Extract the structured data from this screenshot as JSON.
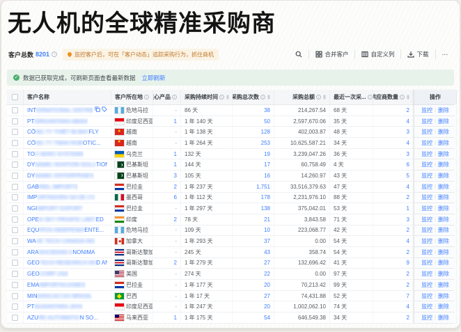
{
  "page": {
    "title": "无人机的全球精准采购商"
  },
  "toolbar": {
    "total_label": "客户总数",
    "total_value": "8201",
    "notice": "监控客户后，可在「客户动态」追踪采购行为，抓住商机",
    "buttons": {
      "merge": "合并客户",
      "customize": "自定义列",
      "download": "下载",
      "more": "⋯"
    }
  },
  "alert": {
    "text": "数据已获取完成，可刷新页面查看最新数据",
    "link": "立即刷新"
  },
  "colors": {
    "accent": "#3d7eff",
    "success": "#4caf6e",
    "warning": "#f08c1f",
    "notice_text": "#c07a2e"
  },
  "table": {
    "columns": [
      {
        "label": "客户名称",
        "info": false,
        "sort": false
      },
      {
        "label": "客户所在地",
        "info": true,
        "sort": false
      },
      {
        "label": "核心产品",
        "info": true,
        "sort": false
      },
      {
        "label": "采购持续时间",
        "info": true,
        "sort": true
      },
      {
        "label": "采购总次数",
        "info": true,
        "sort": true
      },
      {
        "label": "采购总额",
        "info": true,
        "sort": true
      },
      {
        "label": "最近一次采...",
        "info": true,
        "sort": true
      },
      {
        "label": "供应商数量",
        "info": true,
        "sort": true
      },
      {
        "label": "操作",
        "info": false,
        "sort": false
      }
    ],
    "actions": {
      "monitor": "监控",
      "delete": "删除"
    },
    "rows": [
      {
        "pre": "INT",
        "mid": "ERNATIONAL DISTRIB",
        "suf": "...",
        "icons": true,
        "country": "危地马拉",
        "flag": "gt",
        "core": "-",
        "duration": "86 天",
        "count": "38",
        "amount": "214,267.54",
        "last": "68 天",
        "sup": "2"
      },
      {
        "pre": "PT ",
        "mid": "DIRGANTARA ABADI",
        "suf": "",
        "country": "印度尼西亚",
        "flag": "id",
        "core": "1",
        "duration": "1 年 140 天",
        "count": "50",
        "amount": "2,597,670.06",
        "last": "35 天",
        "sup": "4"
      },
      {
        "pre": "CÔ",
        "mid": "NG TY THIẾT BỊ BAY",
        "suf": " FLY",
        "country": "越南",
        "flag": "vn",
        "core": "-",
        "duration": "1 年 138 天",
        "count": "128",
        "amount": "402,003.87",
        "last": "48 天",
        "sup": "3"
      },
      {
        "pre": "CÔ",
        "mid": "NG TY TNHH ROB",
        "suf": "OTIC...",
        "country": "越南",
        "flag": "vn",
        "core": "-",
        "duration": "1 年 264 天",
        "count": "253",
        "amount": "10,625,587.21",
        "last": "34 天",
        "sup": "4"
      },
      {
        "pre": "TO",
        "mid": "V AERO SYSTEMS",
        "suf": "",
        "country": "乌克兰",
        "flag": "ua",
        "core": "1",
        "duration": "132 天",
        "count": "19",
        "amount": "3,239,047.26",
        "last": "36 天",
        "sup": "3"
      },
      {
        "pre": "DY",
        "mid": "NAMIC AVIATION SOLU",
        "suf": "TIONS...",
        "country": "巴基斯坦",
        "flag": "pk",
        "core": "1",
        "duration": "144 天",
        "count": "17",
        "amount": "60,758.49",
        "last": "4 天",
        "sup": "6"
      },
      {
        "pre": "DY",
        "mid": "NAMIC ENTERPRISES",
        "suf": "",
        "country": "巴基斯坦",
        "flag": "pk",
        "core": "3",
        "duration": "105 天",
        "count": "16",
        "amount": "14,260.97",
        "last": "43 天",
        "sup": "5"
      },
      {
        "pre": "GAB",
        "mid": "RIEL IMPORTS",
        "suf": "",
        "country": "巴拉圭",
        "flag": "py",
        "core": "2",
        "duration": "1 年 237 天",
        "count": "1,751",
        "amount": "33,516,379.63",
        "last": "47 天",
        "sup": "4"
      },
      {
        "pre": "IMP",
        "mid": "ORTADORA SA DE CV",
        "suf": "",
        "country": "墨西哥",
        "flag": "mx",
        "core": "6",
        "duration": "1 年 112 天",
        "count": "178",
        "amount": "2,231,976.10",
        "last": "88 天",
        "sup": "2"
      },
      {
        "pre": "NGI",
        "mid": " IMPORT EXPORT",
        "suf": "",
        "country": "巴拉圭",
        "flag": "py",
        "core": "-",
        "duration": "1 年 297 天",
        "count": "138",
        "amount": "375,042.01",
        "last": "53 天",
        "sup": "1"
      },
      {
        "pre": "OPE",
        "mid": "N SKY PRIVATE LIMIT",
        "suf": "ED",
        "country": "印度",
        "flag": "in",
        "core": "2",
        "duration": "78 天",
        "count": "21",
        "amount": "3,843.58",
        "last": "71 天",
        "sup": "3"
      },
      {
        "pre": "EQU",
        "mid": "IPOS INDEPENDI",
        "suf": "ENTE...",
        "country": "危地马拉",
        "flag": "gt",
        "core": "-",
        "duration": "109 天",
        "count": "10",
        "amount": "223,068.77",
        "last": "42 天",
        "sup": "2"
      },
      {
        "pre": "WA",
        "mid": "VE TECH CANADA INC",
        "suf": "",
        "country": "加拿大",
        "flag": "ca",
        "core": "-",
        "duration": "1 年 293 天",
        "count": "37",
        "amount": "0.00",
        "last": "54 天",
        "sup": "4"
      },
      {
        "pre": "ARA",
        "mid": " SOCIEDAD A",
        "suf": "NONIMA",
        "country": "哥斯达黎加",
        "flag": "cr",
        "core": "-",
        "duration": "245 天",
        "count": "43",
        "amount": "358.74",
        "last": "54 天",
        "sup": "2"
      },
      {
        "pre": "GEO",
        "mid": "TECH RESEARCH AN",
        "suf": "D AN...",
        "country": "哥斯达黎加",
        "flag": "cr",
        "core": "2",
        "duration": "1 年 279 天",
        "count": "27",
        "amount": "132,696.42",
        "last": "41 天",
        "sup": "9"
      },
      {
        "pre": "GEO",
        "mid": " CORP USA",
        "suf": "",
        "country": "美国",
        "flag": "us",
        "core": "-",
        "duration": "274 天",
        "count": "22",
        "amount": "0.00",
        "last": "97 天",
        "sup": "2"
      },
      {
        "pre": "EMA",
        "mid": " IMPORTACIONES",
        "suf": "",
        "country": "巴拉圭",
        "flag": "py",
        "core": "-",
        "duration": "1 年 177 天",
        "count": "20",
        "amount": "70,213.42",
        "last": "99 天",
        "sup": "2"
      },
      {
        "pre": "MIN",
        "mid": "ERACAO DO BRASIL",
        "suf": "",
        "country": "巴西",
        "flag": "br",
        "core": "-",
        "duration": "1 年 17 天",
        "count": "27",
        "amount": "74,431.88",
        "last": "52 天",
        "sup": "7"
      },
      {
        "pre": "PT ",
        "mid": "NUSANTARA JAYA",
        "suf": "",
        "country": "印度尼西亚",
        "flag": "id",
        "core": "-",
        "duration": "1 年 247 天",
        "count": "20",
        "amount": "1,002,062.10",
        "last": "74 天",
        "sup": "4"
      },
      {
        "pre": "AZU",
        "mid": "RE AUTOMATIO",
        "suf": "N SO...",
        "country": "马来西亚",
        "flag": "my",
        "core": "1",
        "duration": "1 年 175 天",
        "count": "54",
        "amount": "646,549.38",
        "last": "34 天",
        "sup": "2"
      }
    ]
  }
}
